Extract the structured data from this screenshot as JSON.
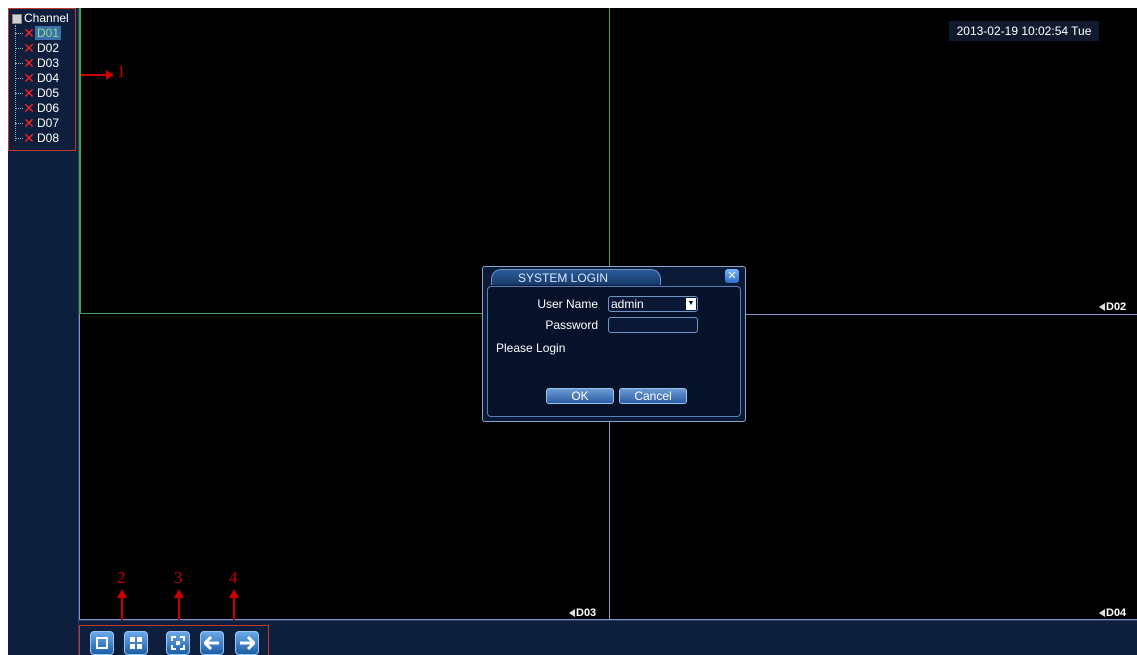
{
  "sidebar": {
    "root_label": "Channel",
    "channels": [
      {
        "label": "D01",
        "selected": true
      },
      {
        "label": "D02",
        "selected": false
      },
      {
        "label": "D03",
        "selected": false
      },
      {
        "label": "D04",
        "selected": false
      },
      {
        "label": "D05",
        "selected": false
      },
      {
        "label": "D06",
        "selected": false
      },
      {
        "label": "D07",
        "selected": false
      },
      {
        "label": "D08",
        "selected": false
      }
    ]
  },
  "video": {
    "timestamp": "2013-02-19 10:02:54 Tue",
    "cam_labels": {
      "d02": "D02",
      "d03": "D03",
      "d04": "D04"
    },
    "colors": {
      "active_border": "#3fa34d",
      "grid_line": "#8a8fd0",
      "background": "#000000"
    }
  },
  "annotations": {
    "n1": "1",
    "n2": "2",
    "n3": "3",
    "n4": "4",
    "color": "#cc0000"
  },
  "toolbar": {
    "icons": [
      "single-view-icon",
      "quad-view-icon",
      "fullscreen-icon",
      "arrow-left-icon",
      "arrow-right-icon"
    ]
  },
  "login": {
    "title": "SYSTEM LOGIN",
    "username_label": "User Name",
    "username_value": "admin",
    "password_label": "Password",
    "password_value": "",
    "status": "Please Login",
    "ok_label": "OK",
    "cancel_label": "Cancel"
  }
}
